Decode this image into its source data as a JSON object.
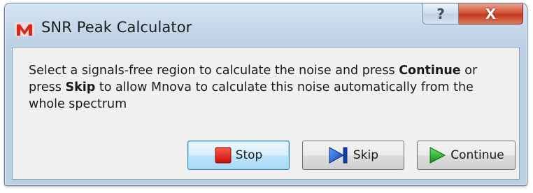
{
  "window": {
    "title": "SNR Peak Calculator",
    "app_icon": "mnova-logo-icon",
    "help_button": "?",
    "close_button": "X"
  },
  "dialog": {
    "message": {
      "part1": "Select a signals-free region to calculate the noise and press ",
      "continue_word": "Continue",
      "part2": " or press ",
      "skip_word": "Skip",
      "part3": " to allow Mnova to calculate this noise automatically from the whole spectrum"
    },
    "buttons": {
      "stop": {
        "label": "Stop",
        "icon": "stop-square-icon",
        "color": "#e02020"
      },
      "skip": {
        "label": "Skip",
        "icon": "skip-forward-icon",
        "color": "#1a5fd0"
      },
      "continue": {
        "label": "Continue",
        "icon": "play-arrow-icon",
        "color": "#22b022"
      }
    }
  }
}
